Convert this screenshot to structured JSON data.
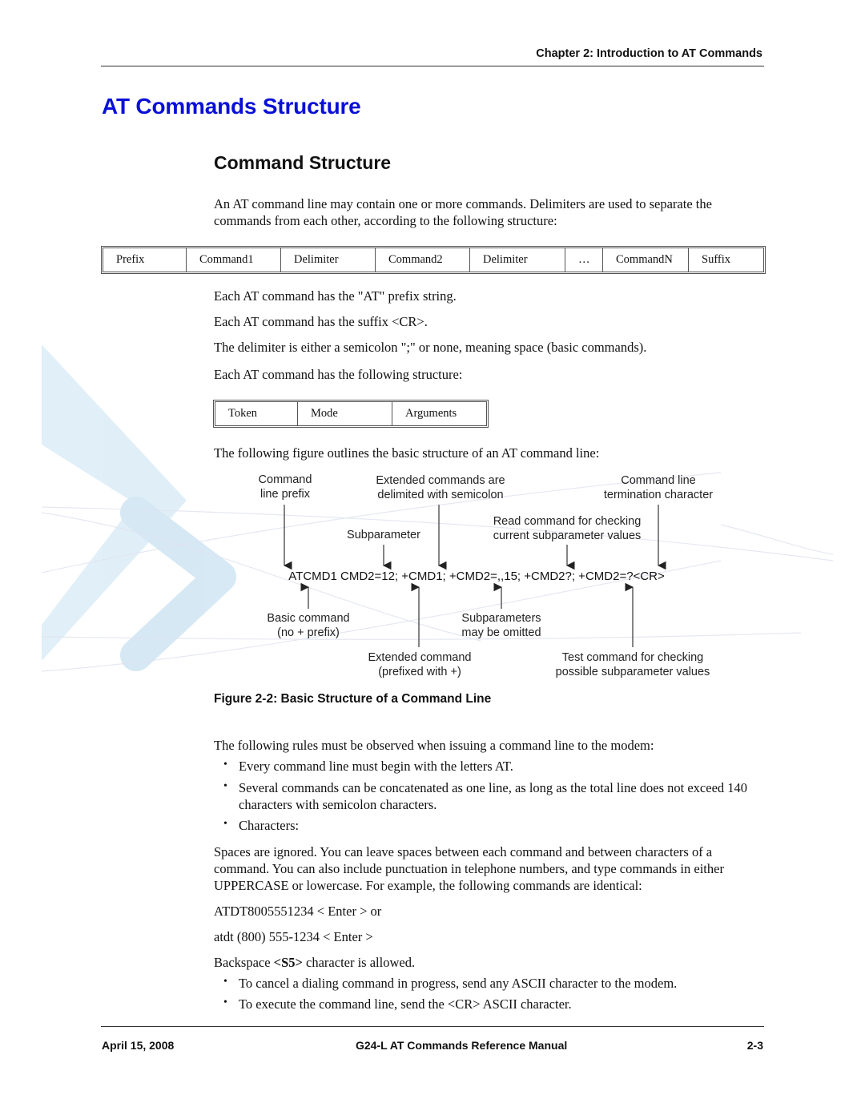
{
  "header": {
    "chapter": "Chapter 2:  Introduction to AT Commands"
  },
  "section": {
    "title": "AT Commands Structure",
    "subtitle": "Command Structure"
  },
  "intro": "An AT command line may contain one or more commands. Delimiters are used to separate the commands from each other, according to the following structure:",
  "structure_table": {
    "cells": [
      "Prefix",
      "Command1",
      "Delimiter",
      "Command2",
      "Delimiter",
      "…",
      "CommandN",
      "Suffix"
    ]
  },
  "notes": [
    "Each AT command has the \"AT\" prefix string.",
    "Each AT command has the suffix <CR>.",
    "The delimiter is either a semicolon \";\" or none, meaning space (basic commands).",
    "Each AT command has the following structure:"
  ],
  "command_table": {
    "cells": [
      "Token",
      "Mode",
      "Arguments"
    ]
  },
  "figure_intro": "The following figure outlines the basic structure of an AT command line:",
  "figure": {
    "command_line": "ATCMD1 CMD2=12; +CMD1; +CMD2=,,15; +CMD2?; +CMD2=?<CR>",
    "labels_top": {
      "prefix_1": "Command",
      "prefix_2": "line prefix",
      "extended_1": "Extended commands are",
      "extended_2": "delimited with semicolon",
      "termination_1": "Command line",
      "termination_2": "termination character",
      "subparameter": "Subparameter",
      "read_1": "Read command for checking",
      "read_2": "current subparameter values"
    },
    "labels_bottom": {
      "basic_1": "Basic command",
      "basic_2": "(no + prefix)",
      "omitted_1": "Subparameters",
      "omitted_2": "may be omitted",
      "extcmd_1": "Extended command",
      "extcmd_2": "(prefixed with +)",
      "test_1": "Test command for checking",
      "test_2": "possible subparameter values"
    },
    "caption": "Figure 2-2: Basic Structure of a Command Line"
  },
  "rules_intro": "The following rules must be observed when issuing a command line to the modem:",
  "rules": [
    "Every command line must begin with the letters AT.",
    "Several commands can be concatenated as one line, as long as the total line does not exceed 140 characters with semicolon characters.",
    "Characters:"
  ],
  "spaces_paragraph": "Spaces are ignored. You can leave spaces between each command and between characters of a command. You can also include punctuation in telephone numbers, and type commands in either UPPERCASE or lowercase. For example, the following commands are identical:",
  "examples": [
    "ATDT8005551234 < Enter > or",
    "atdt (800) 555-1234 < Enter >"
  ],
  "backspace": {
    "pre": "Backspace ",
    "bold": "<S5>",
    "post": " character is allowed."
  },
  "final_rules": [
    "To cancel a dialing command in progress, send any ASCII character to the modem.",
    "To execute the command line, send the <CR> ASCII character."
  ],
  "bullet_glyph": "•",
  "footer": {
    "date": "April 15, 2008",
    "manual": "G24-L AT Commands Reference Manual",
    "page": "2-3"
  },
  "colors": {
    "title_blue": "#0a10d6",
    "watermark_blue": "#cfe6f3"
  }
}
